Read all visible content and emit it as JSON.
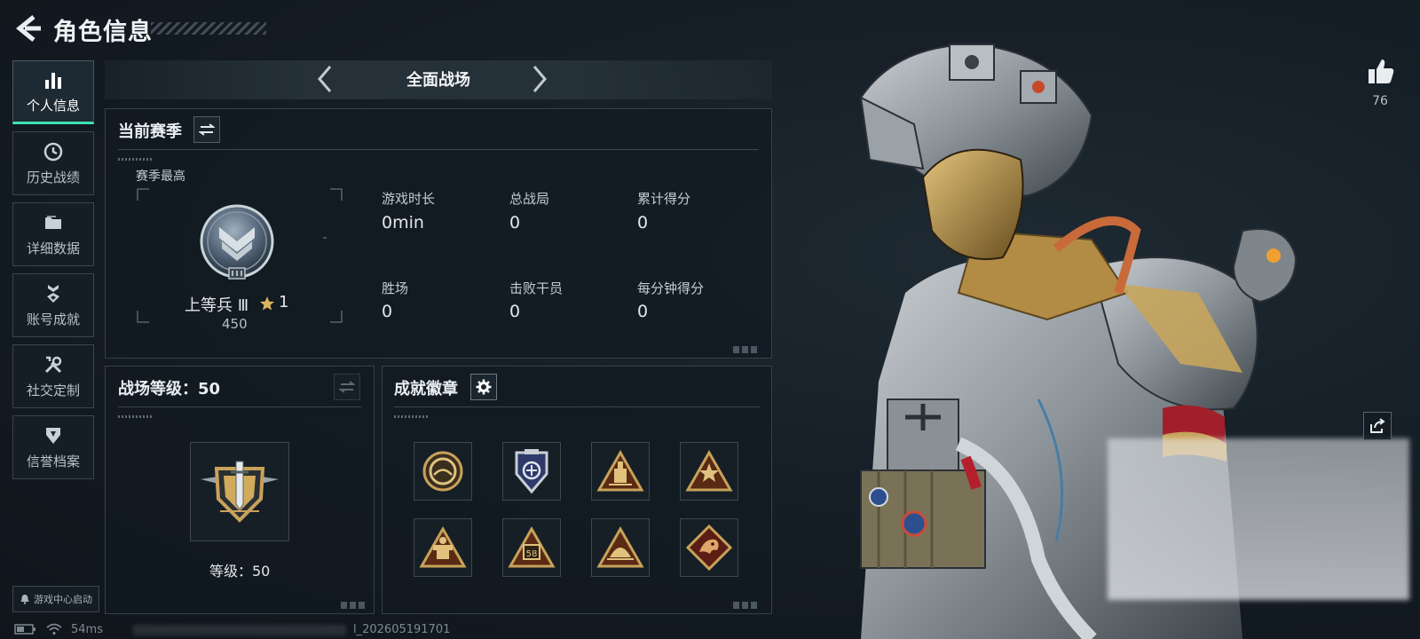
{
  "header": {
    "title": "角色信息"
  },
  "sidebar": {
    "items": [
      {
        "label": "个人信息",
        "icon": "bar-chart-icon",
        "active": true
      },
      {
        "label": "历史战绩",
        "icon": "clock-icon",
        "active": false
      },
      {
        "label": "详细数据",
        "icon": "folder-icon",
        "active": false
      },
      {
        "label": "账号成就",
        "icon": "medal-icon",
        "active": false
      },
      {
        "label": "社交定制",
        "icon": "tools-icon",
        "active": false
      },
      {
        "label": "信誉档案",
        "icon": "shield-badge-icon",
        "active": false
      }
    ],
    "game_center": "游戏中心启动"
  },
  "mode": {
    "label": "全面战场"
  },
  "season": {
    "title": "当前赛季",
    "best_label": "赛季最高",
    "rank_name": "上等兵 Ⅲ",
    "stars": "1",
    "points": "450",
    "stats": [
      {
        "label": "游戏时长",
        "value": "0min"
      },
      {
        "label": "总战局",
        "value": "0"
      },
      {
        "label": "累计得分",
        "value": "0"
      },
      {
        "label": "胜场",
        "value": "0"
      },
      {
        "label": "击败干员",
        "value": "0"
      },
      {
        "label": "每分钟得分",
        "value": "0"
      }
    ]
  },
  "battlefield": {
    "title": "战场等级：50",
    "level_text": "等级：50"
  },
  "achievements": {
    "title": "成就徽章",
    "badges": [
      "ring-badge-icon",
      "shield-crest-badge-icon",
      "triangle-tower-badge-icon",
      "triangle-star-badge-icon",
      "triangle-machine-badge-icon",
      "triangle-58-badge-icon",
      "triangle-dome-badge-icon",
      "dragon-badge-icon"
    ],
    "badge_58_text": "58"
  },
  "status_bar": {
    "ping": "54ms",
    "build": "l_202605191701"
  },
  "social": {
    "likes": "76"
  },
  "colors": {
    "accent": "#3fe0b4",
    "gold": "#c8a25a",
    "panel_border": "#34414a"
  }
}
